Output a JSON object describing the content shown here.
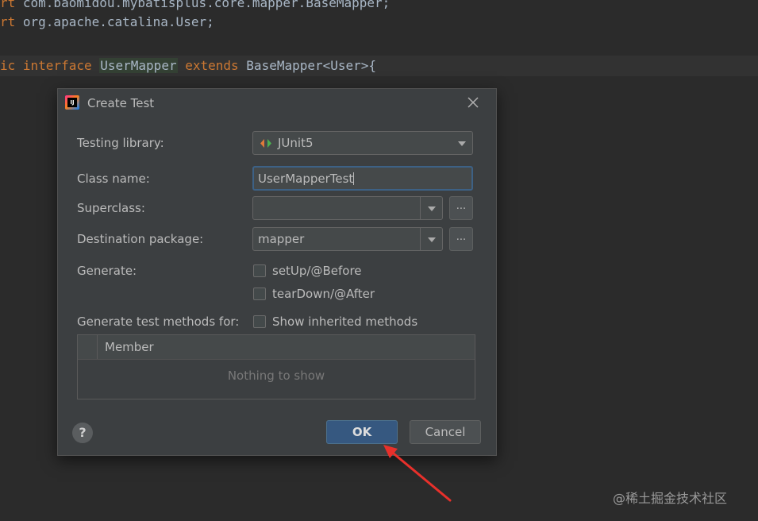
{
  "editor": {
    "line1": {
      "kw": "rt",
      "rest": " com.baomidou.mybatisplus.core.mapper.BaseMapper;"
    },
    "line2": {
      "kw": "rt",
      "rest": " org.apache.catalina.User;"
    },
    "line3": {
      "kw1": "ic",
      "kw2": "interface",
      "name": "UserMapper",
      "kw3": "extends",
      "rest": "BaseMapper<User>{"
    }
  },
  "dialog": {
    "title": "Create Test",
    "testing_library": {
      "label": "Testing library:",
      "value": "JUnit5"
    },
    "class_name": {
      "label": "Class name:",
      "value": "UserMapperTest"
    },
    "superclass": {
      "label": "Superclass:",
      "value": "",
      "browse": "..."
    },
    "destination_package": {
      "label": "Destination package:",
      "value": "mapper",
      "browse": "..."
    },
    "generate": {
      "label": "Generate:",
      "options": [
        {
          "label": "setUp/@Before",
          "checked": false
        },
        {
          "label": "tearDown/@After",
          "checked": false
        }
      ]
    },
    "methods_for": {
      "label": "Generate test methods for:",
      "show_inherited": "Show inherited methods"
    },
    "table": {
      "column": "Member",
      "empty_text": "Nothing to show"
    },
    "help": "?",
    "ok": "OK",
    "cancel": "Cancel"
  },
  "watermark": "@稀土掘金技术社区",
  "colors": {
    "accent": "#365880",
    "annotation": "#e8302b"
  }
}
